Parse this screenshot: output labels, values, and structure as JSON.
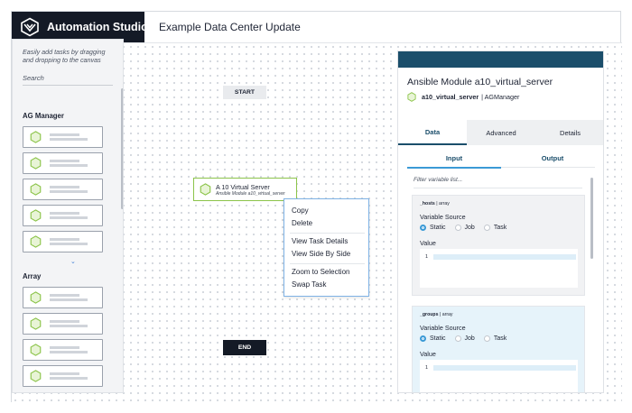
{
  "header": {
    "brand_name": "Automation Studio",
    "page_title": "Example Data Center Update"
  },
  "palette": {
    "hint": "Easily add tasks by dragging and dropping to the canvas",
    "search_placeholder": "Search",
    "sections": [
      {
        "title": "AG Manager",
        "tile_count": 5
      },
      {
        "title": "Array",
        "tile_count": 4
      }
    ]
  },
  "canvas": {
    "start_label": "START",
    "end_label": "END",
    "task_node": {
      "title": "A 10 Virtual Server",
      "subtitle": "Ansible Module a10_virtual_server"
    },
    "context_menu": [
      "Copy",
      "Delete",
      "View Task Details",
      "View Side By Side",
      "Zoom to Selection",
      "Swap Task"
    ]
  },
  "details_panel": {
    "title": "Ansible Module a10_virtual_server",
    "module_name": "a10_virtual_server",
    "module_app": "| AGManager",
    "tabs": [
      "Data",
      "Advanced",
      "Details"
    ],
    "active_tab": "Data",
    "io_tabs": [
      "Input",
      "Output"
    ],
    "active_io_tab": "Input",
    "filter_placeholder": "Filter variable list...",
    "variables": [
      {
        "name": "_hosts",
        "type": "| array",
        "source_label": "Variable Source",
        "options": [
          "Static",
          "Job",
          "Task"
        ],
        "selected": "Static",
        "value_label": "Value",
        "line_number": "1"
      },
      {
        "name": "_groups",
        "type": "| array",
        "source_label": "Variable Source",
        "options": [
          "Static",
          "Job",
          "Task"
        ],
        "selected": "Static",
        "value_label": "Value",
        "line_number": "1"
      }
    ]
  },
  "colors": {
    "brand_bg": "#141a26",
    "panel_header": "#1b4e6b",
    "task_green": "#8cc44a",
    "context_border": "#7fb3e6",
    "radio_blue": "#3b9ad6"
  }
}
